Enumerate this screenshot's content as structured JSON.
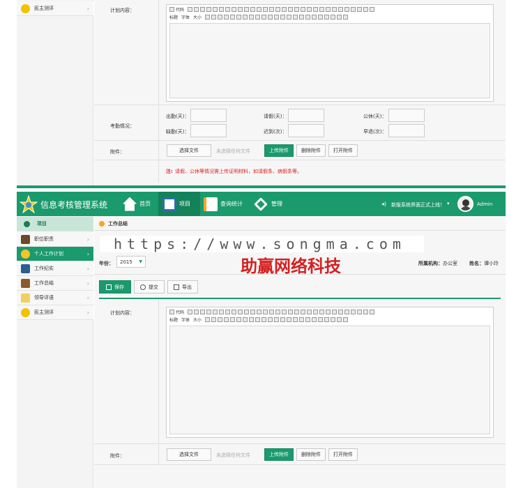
{
  "top": {
    "sidebar_item": {
      "label": "民主测评"
    },
    "plan_label": "计划内容：",
    "attendance_label": "考勤情况：",
    "fields": [
      {
        "label": "出勤(天)："
      },
      {
        "label": "请假(天)："
      },
      {
        "label": "公休(天)："
      },
      {
        "label": "缺勤(天)："
      },
      {
        "label": "迟到(次)："
      },
      {
        "label": "早退(次)："
      }
    ],
    "attachment_label": "附件：",
    "choose_file": "选择文件",
    "no_file": "未选择任何文件",
    "upload": "上传附件",
    "delete": "删除附件",
    "open": "打开附件",
    "note_prefix": "注:",
    "note": "请假、公休等情况需上传证明材料，如请假条、病假条等。"
  },
  "toolbar": {
    "row1_code": "代码",
    "row2_title": "标题",
    "row2_font": "字体",
    "row2_size": "大小"
  },
  "header": {
    "app_title": "信息考核管理系统",
    "nav": [
      {
        "label": "首页"
      },
      {
        "label": "项目"
      },
      {
        "label": "查询统计"
      },
      {
        "label": "管理"
      }
    ],
    "announcement": "新版系统界面正式上线！",
    "user": "Admin"
  },
  "sidebar": {
    "head": "项目",
    "items": [
      {
        "label": "职位职责"
      },
      {
        "label": "个人工作计划"
      },
      {
        "label": "工作纪实"
      },
      {
        "label": "工作总结"
      },
      {
        "label": "领导评语"
      },
      {
        "label": "民主测评"
      }
    ]
  },
  "bottom": {
    "breadcrumb": "工作总结",
    "watermark_url": "https://www.songma.com",
    "watermark_text": "助赢网络科技",
    "year_label": "年份：",
    "year_value": "2015",
    "org_label": "所属机构：",
    "org_value": "办公室",
    "name_label": "姓名：",
    "name_value": "谭小玲",
    "save": "保存",
    "submit": "提交",
    "export": "导出",
    "plan_label": "计划内容：",
    "attachment_label": "附件：",
    "choose_file": "选择文件",
    "no_file": "未选择任何文件",
    "upload": "上传附件",
    "delete": "删除附件",
    "open": "打开附件"
  },
  "colors": {
    "brand": "#1a9a6d",
    "note_red": "#e02020"
  }
}
